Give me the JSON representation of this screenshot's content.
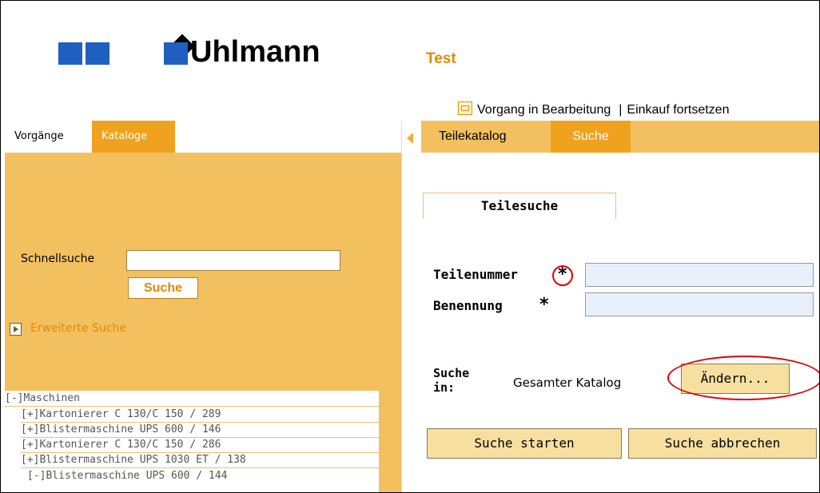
{
  "brand": {
    "logo_text": "Uhlmann",
    "app_title": "Test"
  },
  "top_links": {
    "cart_label": "Vorgang in Bearbeitung",
    "separator": "|",
    "continue_label": "Einkauf fortsetzen"
  },
  "left_tabs": [
    {
      "label": "Vorgänge"
    },
    {
      "label": "Kataloge"
    }
  ],
  "quick_search": {
    "label": "Schnellsuche",
    "value": "",
    "button_label": "Suche",
    "advanced_label": "Erweiterte Suche"
  },
  "tree": {
    "items": [
      {
        "label": "[-]Maschinen"
      },
      {
        "label": "[+]Kartonierer C 130/C 150 / 289"
      },
      {
        "label": "[+]Blistermaschine UPS 600 / 146"
      },
      {
        "label": "[+]Kartonierer C 130/C 150 / 286"
      },
      {
        "label": "[+]Blistermaschine UPS 1030 ET / 138"
      },
      {
        "label": "[-]Blistermaschine UPS 600 / 144"
      }
    ]
  },
  "right_tabs": [
    {
      "label": "Teilekatalog"
    },
    {
      "label": "Suche"
    }
  ],
  "parts_search": {
    "section_label": "Teilesuche",
    "part_number_label": "Teilenummer",
    "name_label": "Benennung",
    "required_marker": "*",
    "part_number_value": "",
    "name_value": "",
    "scope_label": "Suche in:",
    "scope_value": "Gesamter Katalog",
    "change_button": "Ändern...",
    "start_button": "Suche starten",
    "cancel_button": "Suche abbrechen"
  },
  "colors": {
    "accent": "#f0a21e",
    "panel": "#f3c060",
    "brand_blue": "#1f5fbf",
    "highlight_red": "#e00000"
  }
}
